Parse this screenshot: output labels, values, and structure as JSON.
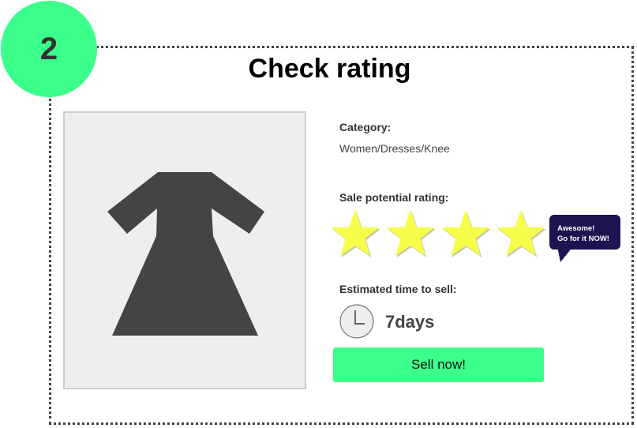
{
  "step": {
    "number": "2"
  },
  "page": {
    "title": "Check rating"
  },
  "product": {
    "image_icon": "dress-icon"
  },
  "category": {
    "label": "Category:",
    "value": "Women/Dresses/Knee"
  },
  "rating": {
    "label": "Sale potential rating:",
    "stars_filled": 4,
    "stars_total": 4,
    "star_icon": "star-icon",
    "star_color": "#f5ff4a",
    "bubble_line1": "Awesome!",
    "bubble_line2": "Go for it NOW!"
  },
  "estimate": {
    "label": "Estimated time to sell:",
    "value": "7days",
    "icon": "clock-icon"
  },
  "actions": {
    "sell_label": "Sell now!"
  },
  "colors": {
    "accent": "#3bff8a",
    "bubble": "#1e1450",
    "product_bg": "#eeeeee"
  }
}
